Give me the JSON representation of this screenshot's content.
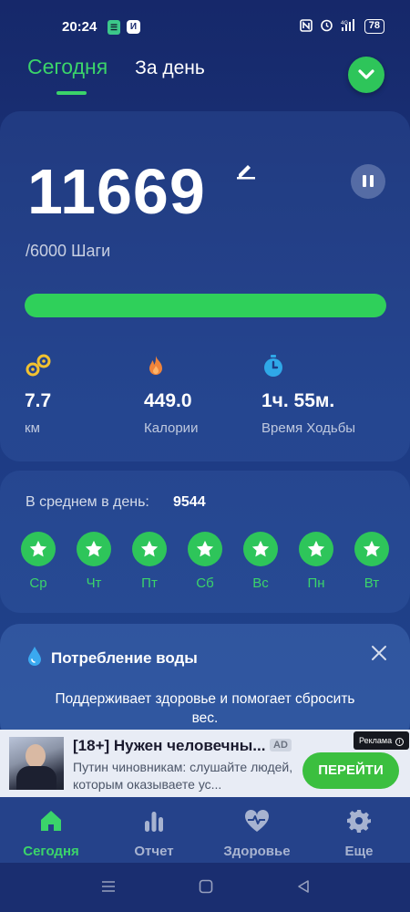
{
  "status_bar": {
    "time": "20:24",
    "app_badge_1": "☰",
    "app_badge_2": "И",
    "network": "4G",
    "battery": "78"
  },
  "header": {
    "tabs": [
      {
        "label": "Сегодня",
        "active": true
      },
      {
        "label": "За день",
        "active": false
      }
    ],
    "action_icon": "chevron-down-icon"
  },
  "steps": {
    "value": "11669",
    "goal_text": "/6000 Шаги",
    "progress_fraction": 1.0
  },
  "stats": [
    {
      "icon": "distance-icon",
      "value": "7.7",
      "label": "км"
    },
    {
      "icon": "fire-icon",
      "value": "449.0",
      "label": "Калории"
    },
    {
      "icon": "stopwatch-icon",
      "value": "1ч. 55м.",
      "label": "Время Ходьбы"
    }
  ],
  "average": {
    "label": "В среднем в день:",
    "value": "9544",
    "days": [
      "Ср",
      "Чт",
      "Пт",
      "Сб",
      "Вс",
      "Пн",
      "Вт"
    ]
  },
  "water": {
    "title": "Потребление воды",
    "description": "Поддерживает здоровье и помогает сбросить вес."
  },
  "ad": {
    "title": "[18+] Нужен человечны...",
    "badge": "AD",
    "text": "Путин чиновникам: слушайте людей, которым оказываете ус...",
    "button": "ПЕРЕЙТИ",
    "mark": "Реклама"
  },
  "bottom_nav": [
    {
      "label": "Сегодня",
      "icon": "home-icon",
      "active": true
    },
    {
      "label": "Отчет",
      "icon": "bar-chart-icon",
      "active": false
    },
    {
      "label": "Здоровье",
      "icon": "heart-pulse-icon",
      "active": false
    },
    {
      "label": "Еще",
      "icon": "gear-icon",
      "active": false
    }
  ],
  "colors": {
    "accent": "#2ec55a",
    "background": "#1d3b84",
    "ad_button": "#3bbf3f"
  }
}
